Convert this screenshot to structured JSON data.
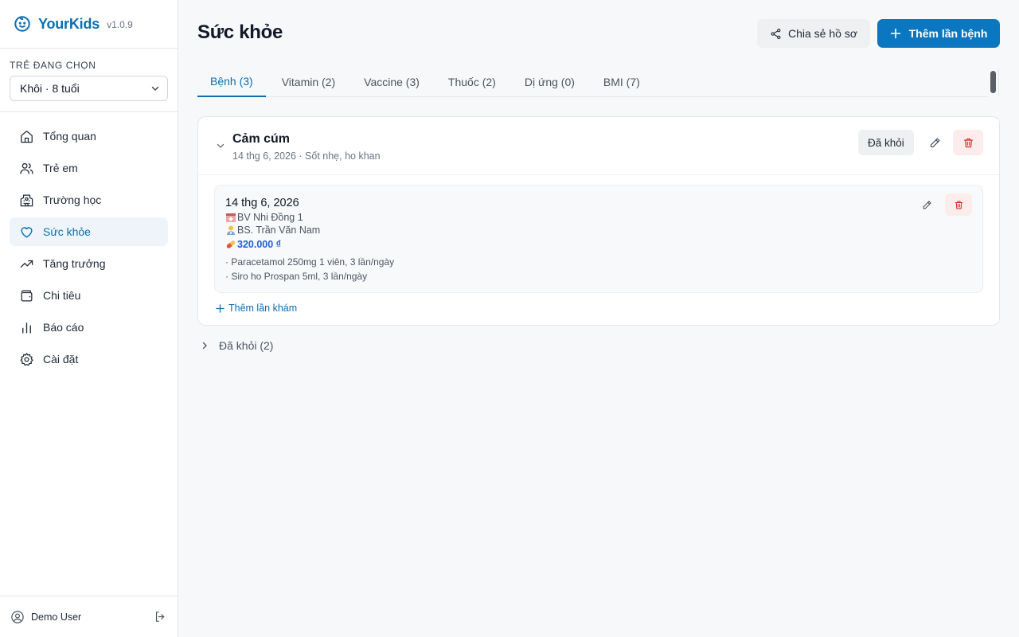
{
  "app": {
    "name": "YourKids",
    "version": "v1.0.9",
    "accent": "#0b6fb0"
  },
  "child_selector": {
    "label": "TRẺ ĐANG CHỌN",
    "selected": "Khôi · 8 tuổi"
  },
  "nav": [
    {
      "label": "Tổng quan",
      "icon": "home-icon"
    },
    {
      "label": "Trẻ em",
      "icon": "users-icon"
    },
    {
      "label": "Trường học",
      "icon": "school-icon"
    },
    {
      "label": "Sức khỏe",
      "icon": "heart-icon",
      "active": true
    },
    {
      "label": "Tăng trưởng",
      "icon": "trending-up-icon"
    },
    {
      "label": "Chi tiêu",
      "icon": "wallet-icon"
    },
    {
      "label": "Báo cáo",
      "icon": "bar-chart-icon"
    },
    {
      "label": "Cài đặt",
      "icon": "gear-icon"
    }
  ],
  "user": {
    "name": "Demo User"
  },
  "header": {
    "title": "Sức khỏe",
    "share_label": "Chia sẻ hồ sơ",
    "add_label": "Thêm lần bệnh"
  },
  "tabs": [
    {
      "label": "Bệnh (3)",
      "active": true
    },
    {
      "label": "Vitamin (2)"
    },
    {
      "label": "Vaccine (3)"
    },
    {
      "label": "Thuốc (2)"
    },
    {
      "label": "Dị ứng (0)"
    },
    {
      "label": "BMI (7)"
    }
  ],
  "illness": {
    "title": "Cảm cúm",
    "subtitle": "14 thg 6, 2026 · Sốt nhẹ, ho khan",
    "healed_button": "Đã khỏi",
    "visit": {
      "date": "14 thg 6, 2026",
      "hospital": "BV Nhi Đồng 1",
      "doctor": "BS. Trần Văn Nam",
      "cost": "320.000 ₫",
      "medicines": [
        "· Paracetamol 250mg 1 viên, 3 lần/ngày",
        "· Siro ho Prospan 5ml, 3 lần/ngày"
      ]
    },
    "add_visit_label": "Thêm lần khám"
  },
  "healed_group": {
    "label": "Đã khỏi (2)"
  }
}
